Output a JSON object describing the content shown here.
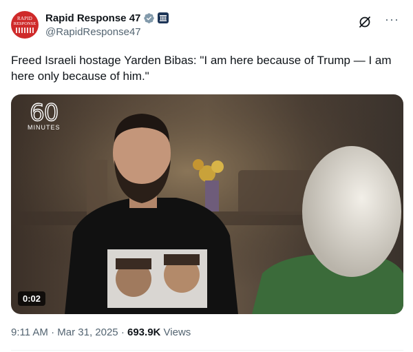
{
  "author": {
    "avatar_text_top": "RAPID",
    "avatar_text_bottom": "RESPONSE",
    "display_name": "Rapid Response 47",
    "handle": "@RapidResponse47"
  },
  "icons": [
    "verified-badge-icon",
    "government-badge-icon",
    "grok-icon",
    "more-icon"
  ],
  "tweet": {
    "text": "Freed Israeli hostage Yarden Bibas: \"I am here because of Trump — I am here only because of him.\""
  },
  "video": {
    "logo_number": "60",
    "logo_text": "MINUTES",
    "duration": "0:02"
  },
  "meta": {
    "time": "9:11 AM",
    "separator": "·",
    "date": "Mar 31, 2025",
    "views_count": "693.9K",
    "views_label": "Views"
  },
  "colors": {
    "text": "#0f1419",
    "secondary": "#536471",
    "verified": "#829aab",
    "avatar": "#cf2a2a"
  }
}
